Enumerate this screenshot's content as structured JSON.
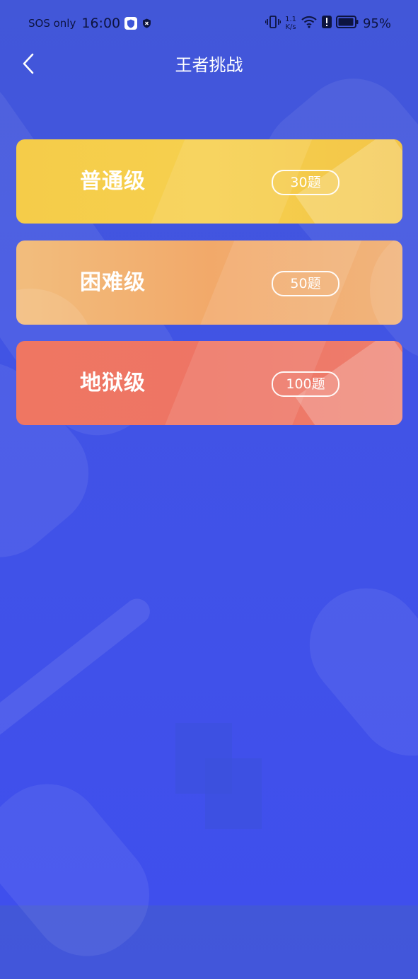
{
  "status_bar": {
    "sos": "SOS only",
    "time": "16:00",
    "speed_value": "1.1",
    "speed_unit": "K/s",
    "battery": "95%"
  },
  "header": {
    "title": "王者挑战"
  },
  "levels": [
    {
      "label": "普通级",
      "count": "30题"
    },
    {
      "label": "困难级",
      "count": "50题"
    },
    {
      "label": "地狱级",
      "count": "100题"
    }
  ],
  "icons": {
    "back": "chevron-left-icon",
    "shield": "shield-icon",
    "vibrate": "vibrate-icon",
    "wifi": "wifi-icon",
    "alert": "alert-icon",
    "battery": "battery-icon"
  },
  "colors": {
    "background": "#4153e6",
    "level_normal": "#f5cc49",
    "level_hard": "#f2b070",
    "level_hell": "#ef7662"
  }
}
